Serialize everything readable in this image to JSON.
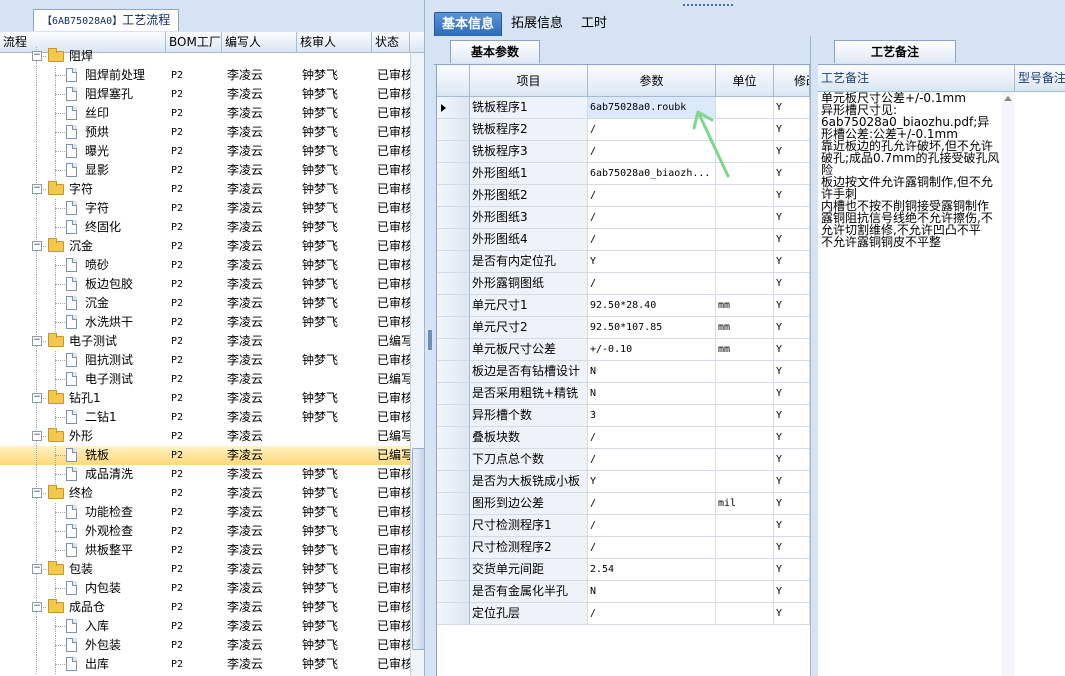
{
  "left_tab": {
    "code": "【6AB75028A0】",
    "title": "工艺流程"
  },
  "tree_columns": {
    "name": "流程",
    "bom": "BOM工厂",
    "writer": "编写人",
    "reviewer": "核审人",
    "status": "状态"
  },
  "tree_rows": [
    {
      "type": "folder",
      "level": 0,
      "label": "阻焊",
      "bom": "",
      "writer": "",
      "reviewer": "",
      "status": ""
    },
    {
      "type": "item",
      "level": 1,
      "label": "阻焊前处理",
      "bom": "P2",
      "writer": "李凌云",
      "reviewer": "钟梦飞",
      "status": "已审核"
    },
    {
      "type": "item",
      "level": 1,
      "label": "阻焊塞孔",
      "bom": "P2",
      "writer": "李凌云",
      "reviewer": "钟梦飞",
      "status": "已审核"
    },
    {
      "type": "item",
      "level": 1,
      "label": "丝印",
      "bom": "P2",
      "writer": "李凌云",
      "reviewer": "钟梦飞",
      "status": "已审核"
    },
    {
      "type": "item",
      "level": 1,
      "label": "预烘",
      "bom": "P2",
      "writer": "李凌云",
      "reviewer": "钟梦飞",
      "status": "已审核"
    },
    {
      "type": "item",
      "level": 1,
      "label": "曝光",
      "bom": "P2",
      "writer": "李凌云",
      "reviewer": "钟梦飞",
      "status": "已审核"
    },
    {
      "type": "item",
      "level": 1,
      "label": "显影",
      "bom": "P2",
      "writer": "李凌云",
      "reviewer": "钟梦飞",
      "status": "已审核"
    },
    {
      "type": "folder",
      "level": 0,
      "label": "字符",
      "bom": "P2",
      "writer": "李凌云",
      "reviewer": "钟梦飞",
      "status": "已审核"
    },
    {
      "type": "item",
      "level": 1,
      "label": "字符",
      "bom": "P2",
      "writer": "李凌云",
      "reviewer": "钟梦飞",
      "status": "已审核"
    },
    {
      "type": "item",
      "level": 1,
      "label": "终固化",
      "bom": "P2",
      "writer": "李凌云",
      "reviewer": "钟梦飞",
      "status": "已审核"
    },
    {
      "type": "folder",
      "level": 0,
      "label": "沉金",
      "bom": "P2",
      "writer": "李凌云",
      "reviewer": "钟梦飞",
      "status": "已审核"
    },
    {
      "type": "item",
      "level": 1,
      "label": "喷砂",
      "bom": "P2",
      "writer": "李凌云",
      "reviewer": "钟梦飞",
      "status": "已审核"
    },
    {
      "type": "item",
      "level": 1,
      "label": "板边包胶",
      "bom": "P2",
      "writer": "李凌云",
      "reviewer": "钟梦飞",
      "status": "已审核"
    },
    {
      "type": "item",
      "level": 1,
      "label": "沉金",
      "bom": "P2",
      "writer": "李凌云",
      "reviewer": "钟梦飞",
      "status": "已审核"
    },
    {
      "type": "item",
      "level": 1,
      "label": "水洗烘干",
      "bom": "P2",
      "writer": "李凌云",
      "reviewer": "钟梦飞",
      "status": "已审核"
    },
    {
      "type": "folder",
      "level": 0,
      "label": "电子测试",
      "bom": "P2",
      "writer": "李凌云",
      "reviewer": "",
      "status": "已编写"
    },
    {
      "type": "item",
      "level": 1,
      "label": "阻抗测试",
      "bom": "P2",
      "writer": "李凌云",
      "reviewer": "钟梦飞",
      "status": "已审核"
    },
    {
      "type": "item",
      "level": 1,
      "label": "电子测试",
      "bom": "P2",
      "writer": "李凌云",
      "reviewer": "",
      "status": "已编写"
    },
    {
      "type": "folder",
      "level": 0,
      "label": "钻孔1",
      "bom": "P2",
      "writer": "李凌云",
      "reviewer": "钟梦飞",
      "status": "已审核"
    },
    {
      "type": "item",
      "level": 1,
      "label": "二钻1",
      "bom": "P2",
      "writer": "李凌云",
      "reviewer": "钟梦飞",
      "status": "已审核"
    },
    {
      "type": "folder",
      "level": 0,
      "label": "外形",
      "bom": "P2",
      "writer": "李凌云",
      "reviewer": "",
      "status": "已编写"
    },
    {
      "type": "item",
      "level": 1,
      "label": "铣板",
      "bom": "P2",
      "writer": "李凌云",
      "reviewer": "",
      "status": "已编写",
      "selected": true
    },
    {
      "type": "item",
      "level": 1,
      "label": "成品清洗",
      "bom": "P2",
      "writer": "李凌云",
      "reviewer": "钟梦飞",
      "status": "已审核"
    },
    {
      "type": "folder",
      "level": 0,
      "label": "终检",
      "bom": "P2",
      "writer": "李凌云",
      "reviewer": "钟梦飞",
      "status": "已审核"
    },
    {
      "type": "item",
      "level": 1,
      "label": "功能检查",
      "bom": "P2",
      "writer": "李凌云",
      "reviewer": "钟梦飞",
      "status": "已审核"
    },
    {
      "type": "item",
      "level": 1,
      "label": "外观检查",
      "bom": "P2",
      "writer": "李凌云",
      "reviewer": "钟梦飞",
      "status": "已审核"
    },
    {
      "type": "item",
      "level": 1,
      "label": "烘板整平",
      "bom": "P2",
      "writer": "李凌云",
      "reviewer": "钟梦飞",
      "status": "已审核"
    },
    {
      "type": "folder",
      "level": 0,
      "label": "包装",
      "bom": "P2",
      "writer": "李凌云",
      "reviewer": "钟梦飞",
      "status": "已审核"
    },
    {
      "type": "item",
      "level": 1,
      "label": "内包装",
      "bom": "P2",
      "writer": "李凌云",
      "reviewer": "钟梦飞",
      "status": "已审核"
    },
    {
      "type": "folder",
      "level": 0,
      "label": "成品仓",
      "bom": "P2",
      "writer": "李凌云",
      "reviewer": "钟梦飞",
      "status": "已审核"
    },
    {
      "type": "item",
      "level": 1,
      "label": "入库",
      "bom": "P2",
      "writer": "李凌云",
      "reviewer": "钟梦飞",
      "status": "已审核"
    },
    {
      "type": "item",
      "level": 1,
      "label": "外包装",
      "bom": "P2",
      "writer": "李凌云",
      "reviewer": "钟梦飞",
      "status": "已审核"
    },
    {
      "type": "item",
      "level": 1,
      "label": "出库",
      "bom": "P2",
      "writer": "李凌云",
      "reviewer": "钟梦飞",
      "status": "已审核"
    }
  ],
  "main_tabs": [
    "基本信息",
    "拓展信息",
    "工时"
  ],
  "sub_tab": "基本参数",
  "grid_columns": {
    "item": "项目",
    "param": "参数",
    "unit": "单位",
    "mod": "修改"
  },
  "grid_rows": [
    {
      "item": "铣板程序1",
      "param": "6ab75028a0.roubk",
      "unit": "",
      "mod": "Y",
      "current": true
    },
    {
      "item": "铣板程序2",
      "param": "/",
      "unit": "",
      "mod": "Y"
    },
    {
      "item": "铣板程序3",
      "param": "/",
      "unit": "",
      "mod": "Y"
    },
    {
      "item": "外形图纸1",
      "param": "6ab75028a0_biaozh...",
      "unit": "",
      "mod": "Y"
    },
    {
      "item": "外形图纸2",
      "param": "/",
      "unit": "",
      "mod": "Y"
    },
    {
      "item": "外形图纸3",
      "param": "/",
      "unit": "",
      "mod": "Y"
    },
    {
      "item": "外形图纸4",
      "param": "/",
      "unit": "",
      "mod": "Y"
    },
    {
      "item": "是否有内定位孔",
      "param": "Y",
      "unit": "",
      "mod": "Y"
    },
    {
      "item": "外形露铜图纸",
      "param": "/",
      "unit": "",
      "mod": "Y"
    },
    {
      "item": "单元尺寸1",
      "param": "92.50*28.40",
      "unit": "mm",
      "mod": "Y"
    },
    {
      "item": "单元尺寸2",
      "param": "92.50*107.85",
      "unit": "mm",
      "mod": "Y"
    },
    {
      "item": "单元板尺寸公差",
      "param": "+/-0.10",
      "unit": "mm",
      "mod": "Y"
    },
    {
      "item": "板边是否有钻槽设计",
      "param": "N",
      "unit": "",
      "mod": "Y"
    },
    {
      "item": "是否采用粗铣+精铣",
      "param": "N",
      "unit": "",
      "mod": "Y"
    },
    {
      "item": "异形槽个数",
      "param": "3",
      "unit": "",
      "mod": "Y"
    },
    {
      "item": "叠板块数",
      "param": "/",
      "unit": "",
      "mod": "Y"
    },
    {
      "item": "下刀点总个数",
      "param": "/",
      "unit": "",
      "mod": "Y"
    },
    {
      "item": "是否为大板铣成小板",
      "param": "Y",
      "unit": "",
      "mod": "Y"
    },
    {
      "item": "图形到边公差",
      "param": "/",
      "unit": "mil",
      "mod": "Y"
    },
    {
      "item": "尺寸检测程序1",
      "param": "/",
      "unit": "",
      "mod": "Y"
    },
    {
      "item": "尺寸检测程序2",
      "param": "/",
      "unit": "",
      "mod": "Y"
    },
    {
      "item": "交货单元间距",
      "param": "2.54",
      "unit": "",
      "mod": "Y"
    },
    {
      "item": "是否有金属化半孔",
      "param": "N",
      "unit": "",
      "mod": "Y"
    },
    {
      "item": "定位孔层",
      "param": "/",
      "unit": "",
      "mod": "Y"
    }
  ],
  "right_tab": "工艺备注",
  "right_columns": {
    "remark": "工艺备注",
    "model_remark": "型号备注"
  },
  "remark_text": "单元板尺寸公差+/-0.1mm\n异形槽尺寸见:\n6ab75028a0_biaozhu.pdf;异形槽公差:公差+/-0.1mm\n靠近板边的孔允许破坏,但不允许破孔;成品0.7mm的孔接受破孔风险\n板边按文件允许露铜制作,但不允许手刺\n内槽也不按不削铜接受露铜制作\n露铜阻抗信号线绝不允许擦伤,不允许切割维修,不允许凹凸不平\n不允许露铜铜皮不平整",
  "colors": {
    "accent": "#2a68b8",
    "selected_row": "#ffd878",
    "arrow": "#7fd88a"
  }
}
